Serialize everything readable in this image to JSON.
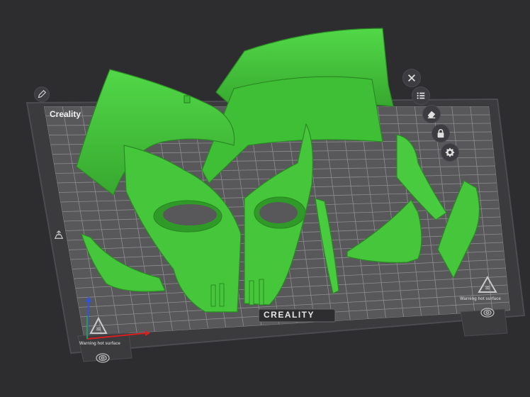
{
  "bed": {
    "brand_top_left": "Creality",
    "brand_bottom": "CREALITY",
    "warning_left": "Warning hot surface",
    "warning_right": "Warning hot surface"
  },
  "toolbar": {
    "buttons": [
      {
        "icon": "close-icon"
      },
      {
        "icon": "list-icon"
      },
      {
        "icon": "eraser-icon"
      },
      {
        "icon": "lock-icon"
      },
      {
        "icon": "gear-icon"
      }
    ]
  },
  "left_tools": [
    {
      "icon": "pencil-icon"
    },
    {
      "icon": "home-view-icon"
    }
  ],
  "colors": {
    "background": "#2d2d30",
    "bed_frame": "#3b3b3e",
    "bed_surface": "#565659",
    "grid": "#8a8a8d",
    "model_green": "#44c83a",
    "model_green_dark": "#2e8f27",
    "axis_x": "#d62020",
    "axis_y": "#2ab52a",
    "axis_z": "#2a55e0"
  }
}
